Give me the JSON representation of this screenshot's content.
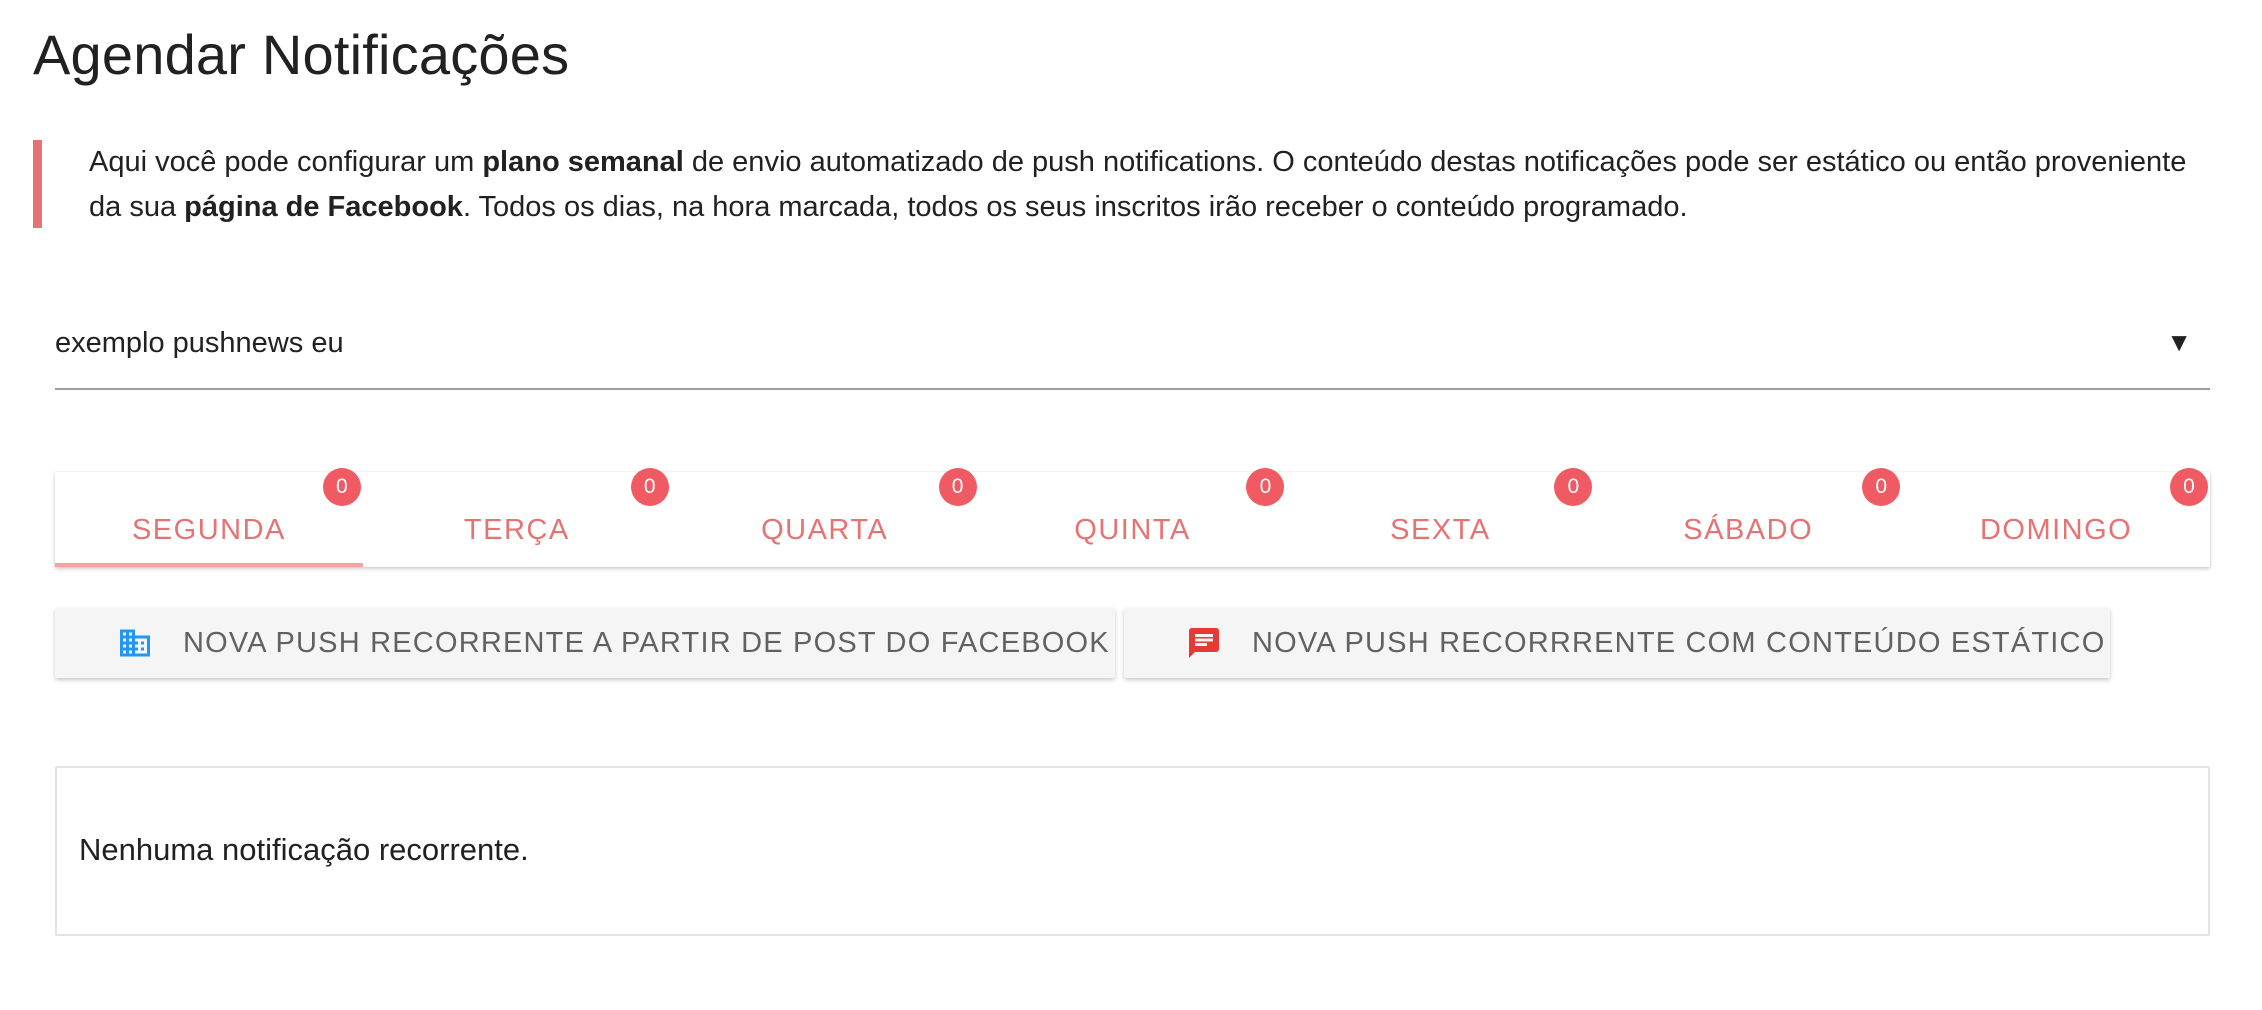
{
  "page": {
    "title": "Agendar Notificações"
  },
  "intro": {
    "part1": "Aqui você pode configurar um ",
    "bold1": "plano semanal",
    "part2": " de envio automatizado de push notifications. O conteúdo destas notificações pode ser estático ou então proveniente da sua ",
    "bold2": "página de Facebook",
    "part3": ". Todos os dias, na hora marcada, todos os seus inscritos irão receber o conteúdo programado."
  },
  "site_select": {
    "value": "exemplo pushnews eu",
    "arrow": "▼"
  },
  "tabs": [
    {
      "label": "SEGUNDA",
      "count": "0",
      "active": true
    },
    {
      "label": "TERÇA",
      "count": "0",
      "active": false
    },
    {
      "label": "QUARTA",
      "count": "0",
      "active": false
    },
    {
      "label": "QUINTA",
      "count": "0",
      "active": false
    },
    {
      "label": "SEXTA",
      "count": "0",
      "active": false
    },
    {
      "label": "SÁBADO",
      "count": "0",
      "active": false
    },
    {
      "label": "DOMINGO",
      "count": "0",
      "active": false
    }
  ],
  "actions": {
    "facebook": {
      "label": "NOVA PUSH RECORRENTE A PARTIR DE POST DO FACEBOOK",
      "icon": "building-icon"
    },
    "static": {
      "label": "NOVA PUSH RECORRRENTE COM CONTEÚDO ESTÁTICO",
      "icon": "message-icon"
    }
  },
  "empty_state": {
    "text": "Nenhuma notificação recorrente."
  },
  "colors": {
    "accent": "#e57373",
    "badge": "#ef5a63",
    "facebook_icon": "#2196f3",
    "static_icon": "#e53935"
  }
}
